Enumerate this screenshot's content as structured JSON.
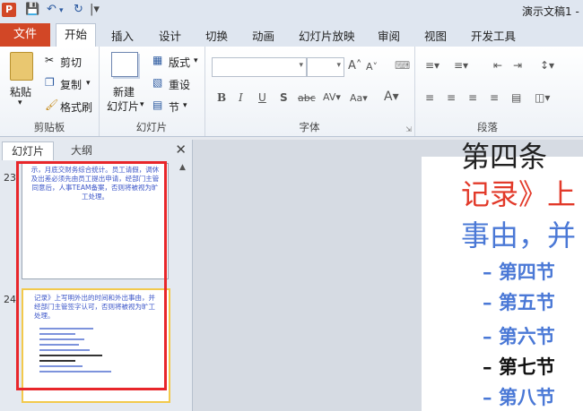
{
  "window": {
    "title": "演示文稿1 -"
  },
  "tabs": [
    "文件",
    "开始",
    "插入",
    "设计",
    "切换",
    "动画",
    "幻灯片放映",
    "审阅",
    "视图",
    "开发工具"
  ],
  "ribbon": {
    "clipboard": {
      "paste": "粘贴",
      "cut": "剪切",
      "copy": "复制",
      "format_painter": "格式刷",
      "label": "剪贴板"
    },
    "slides": {
      "new_slide_1": "新建",
      "new_slide_2": "幻灯片",
      "layout": "版式",
      "reset": "重设",
      "section": "节",
      "label": "幻灯片"
    },
    "font": {
      "label": "字体"
    },
    "paragraph": {
      "label": "段落"
    }
  },
  "panel": {
    "tab_slides": "幻灯片",
    "tab_outline": "大纲",
    "thumbs": [
      {
        "num": "23",
        "text": "示，月底交财务综合统计。员工请假，调休及出差必须先由员工提出申请，经部门主管同意后，人事TEAM备案，否则将被视为旷工处理。"
      },
      {
        "num": "24",
        "text": "记录》上写明外出的时间和外出事由，并经部门主管签字认可，否则将被视为旷工处理。"
      }
    ]
  },
  "slide": {
    "line1": "第四条",
    "line2": "记录》上",
    "line3": "事由，并",
    "bullets": [
      "第四节",
      "第五节",
      "第六节",
      "第七节",
      "第八节"
    ]
  },
  "colors": {
    "file_tab": "#d24726",
    "accent_blue": "#4a78d6",
    "red_text": "#e23a2a",
    "red_box": "#e8262a"
  }
}
